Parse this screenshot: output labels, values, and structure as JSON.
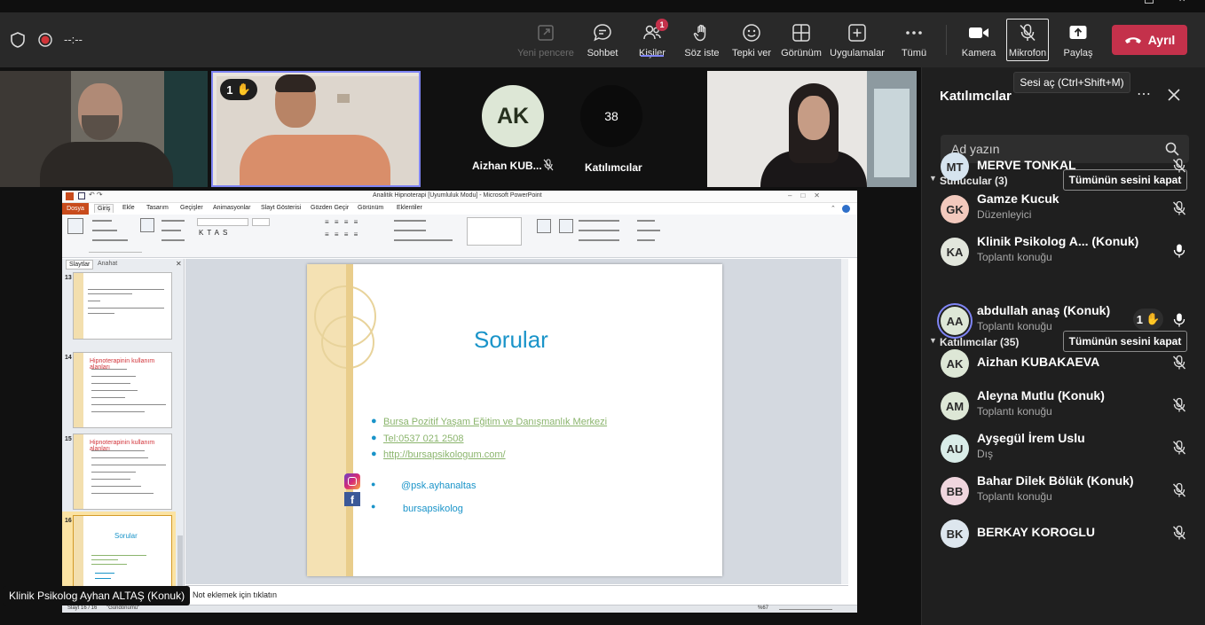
{
  "toolbar": {
    "timer": "--:--",
    "buttons": {
      "popout": "Yeni pencere",
      "chat": "Sohbet",
      "people": "Kişiler",
      "raise_hand": "Söz iste",
      "react": "Tepki ver",
      "view": "Görünüm",
      "apps": "Uygulamalar",
      "more": "Tümü",
      "camera": "Kamera",
      "mic": "Mikrofon",
      "share": "Paylaş"
    },
    "people_badge": "1",
    "leave_label": "Ayrıl",
    "tooltip": "Sesi aç (Ctrl+Shift+M)"
  },
  "stage": {
    "hand_count": "1",
    "tile_aizhan_initials": "AK",
    "tile_aizhan_name": "Aizhan KUB...",
    "tile_count": "38",
    "tile_count_label": "Katılımcılar",
    "presenter_label": "Klinik Psikolog Ayhan ALTAŞ (Konuk)"
  },
  "ppt": {
    "window_title": "Analitik Hipnoterapi [Uyumluluk Modu] - Microsoft PowerPoint",
    "tabs": [
      "Dosya",
      "Giriş",
      "Ekle",
      "Tasarım",
      "Geçişler",
      "Animasyonlar",
      "Slayt Gösterisi",
      "Gözden Geçir",
      "Görünüm",
      "Eklentiler"
    ],
    "panel_tabs": [
      "Slaytlar",
      "Anahat"
    ],
    "thumbs": [
      {
        "num": "13",
        "title": ""
      },
      {
        "num": "14",
        "title": "Hipnoterapinin kullanım alanları"
      },
      {
        "num": "15",
        "title": "Hipnoterapinin kullanım alanları"
      },
      {
        "num": "16",
        "title": "Sorular"
      }
    ],
    "slide": {
      "title": "Sorular",
      "links": [
        "Bursa Pozitif Yaşam Eğitim ve Danışmanlık Merkezi",
        "Tel:0537 021 2508",
        "http://bursapsikologum.com/"
      ],
      "instagram": "@psk.ayhanaltas",
      "facebook": "bursapsikolog"
    },
    "notes_placeholder": "Not eklemek için tıklatın",
    "status_left": "Slayt 16 / 16",
    "status_theme": "\"Gündönümü\"",
    "zoom": "%67"
  },
  "panel": {
    "title": "Katılımcılar",
    "search_placeholder": "Ad yazın",
    "presenters_header": "Sunucular (3)",
    "attendees_header": "Katılımcılar (35)",
    "mute_all": "Tümünün sesini kapat",
    "presenters": [
      {
        "initials": "MT",
        "name": "MERVE TONKAL",
        "role": "",
        "mic": "off",
        "color": "#d6e4ef"
      },
      {
        "initials": "GK",
        "name": "Gamze Kucuk",
        "role": "Düzenleyici",
        "mic": "off",
        "color": "#f2c9bd"
      },
      {
        "initials": "KA",
        "name": "Klinik Psikolog A... (Konuk)",
        "role": "Toplantı konuğu",
        "mic": "on",
        "color": "#e2e6dc"
      }
    ],
    "attendees": [
      {
        "initials": "AA",
        "name": "abdullah anaş (Konuk)",
        "role": "Toplantı konuğu",
        "mic": "on",
        "hand": "1",
        "color": "#dde7d6"
      },
      {
        "initials": "AK",
        "name": "Aizhan KUBAKAEVA",
        "role": "",
        "mic": "off",
        "color": "#dde7d6"
      },
      {
        "initials": "AM",
        "name": "Aleyna Mutlu (Konuk)",
        "role": "Toplantı konuğu",
        "mic": "off",
        "color": "#dde7d6"
      },
      {
        "initials": "AU",
        "name": "Ayşegül İrem Uslu",
        "role": "Dış",
        "mic": "off",
        "color": "#d9ece8"
      },
      {
        "initials": "BB",
        "name": "Bahar Dilek Bölük (Konuk)",
        "role": "Toplantı konuğu",
        "mic": "off",
        "color": "#f0d6de"
      },
      {
        "initials": "BK",
        "name": "BERKAY KOROGLU",
        "role": "",
        "mic": "off",
        "color": "#dde6ee"
      }
    ]
  }
}
